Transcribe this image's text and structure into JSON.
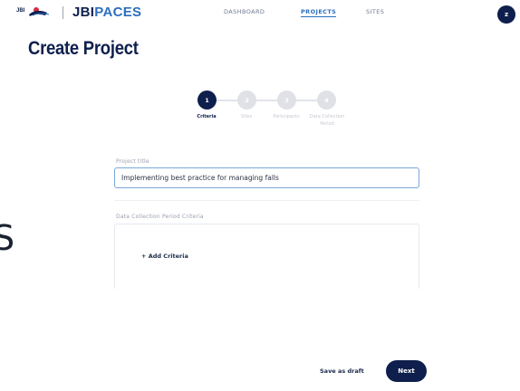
{
  "header": {
    "brand_prefix": "JBI",
    "brand_suffix": "PACES",
    "logo_text": "JBI",
    "nav": {
      "dashboard": "DASHBOARD",
      "projects": "PROJECTS",
      "sites": "SITES"
    },
    "avatar_initial": "z"
  },
  "page": {
    "title": "Create Project"
  },
  "stepper": {
    "steps": [
      {
        "number": "1",
        "label": "Criteria",
        "active": true
      },
      {
        "number": "2",
        "label": "Sites",
        "active": false
      },
      {
        "number": "3",
        "label": "Participants",
        "active": false
      },
      {
        "number": "4",
        "label": "Data Collection Period",
        "active": false
      }
    ]
  },
  "form": {
    "project_title_label": "Project title",
    "project_title_value": "Implementing best practice for managing falls",
    "criteria_label": "Data Collection Period Criteria",
    "add_criteria": "+ Add Criteria"
  },
  "left_fragment": "S",
  "actions": {
    "save_draft": "Save as draft",
    "next": "Next"
  },
  "colors": {
    "navy": "#0e1f4d",
    "accent_blue": "#2c6fbf",
    "inactive_step": "#dfe1e7",
    "logo_red": "#d52b3a"
  }
}
